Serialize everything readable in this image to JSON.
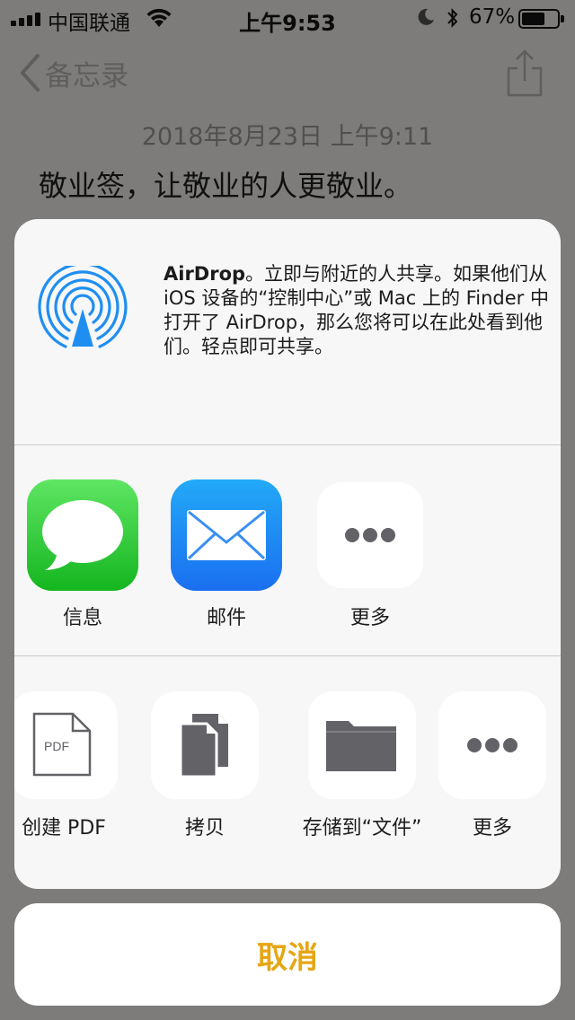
{
  "status_bar": {
    "carrier": "中国联通",
    "time": "上午9:53",
    "battery_percent": "67%",
    "battery_level": 0.67,
    "icons": [
      "signal-icon",
      "wifi-icon",
      "moon-icon",
      "bluetooth-icon",
      "battery-icon"
    ]
  },
  "nav": {
    "back_label": "备忘录",
    "back_icon": "chevron-left-icon",
    "share_icon": "share-icon"
  },
  "note": {
    "date": "2018年8月23日 上午9:11",
    "body": "敬业签，让敬业的人更敬业。"
  },
  "share_sheet": {
    "airdrop": {
      "icon": "airdrop-icon",
      "title": "AirDrop",
      "description": "。立即与附近的人共享。如果他们从 iOS 设备的“控制中心”或 Mac 上的 Finder 中打开了 AirDrop，那么您将可以在此处看到他们。轻点即可共享。"
    },
    "apps": [
      {
        "label": "信息",
        "icon": "messages-icon"
      },
      {
        "label": "邮件",
        "icon": "mail-icon"
      },
      {
        "label": "更多",
        "icon": "more-icon"
      }
    ],
    "actions": [
      {
        "label": "创建 PDF",
        "icon": "pdf-document-icon",
        "icon_text": "PDF"
      },
      {
        "label": "拷贝",
        "icon": "copy-icon"
      },
      {
        "label": "存储到“文件”",
        "icon": "folder-icon"
      },
      {
        "label": "更多",
        "icon": "more-icon"
      }
    ]
  },
  "cancel_label": "取消",
  "colors": {
    "accent": "#e6a614",
    "dim_background": "#7d7c7a",
    "sheet_background": "#f7f7f7",
    "airdrop_blue": "#1f8ef1",
    "action_icon_gray": "#626267"
  }
}
